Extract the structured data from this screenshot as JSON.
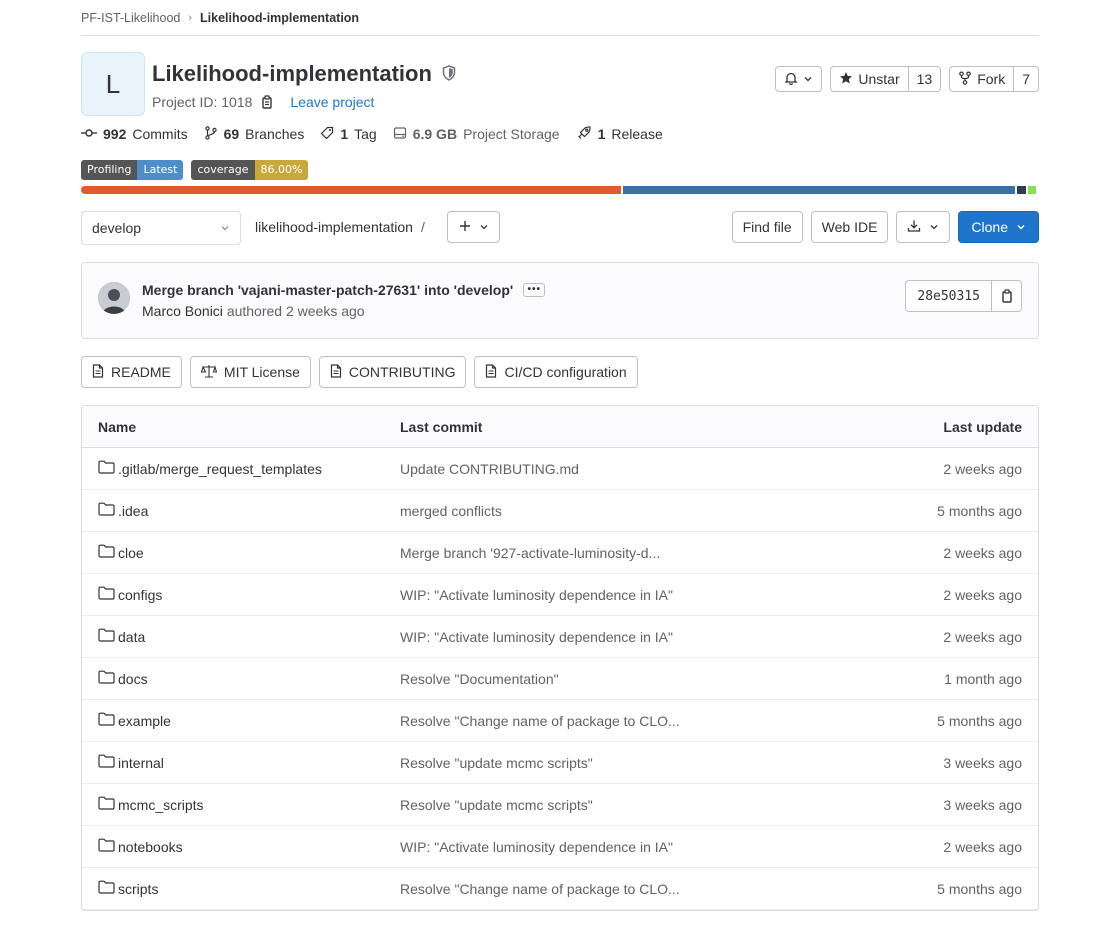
{
  "breadcrumb": {
    "group": "PF-IST-Likelihood",
    "project": "Likelihood-implementation"
  },
  "project": {
    "avatar_letter": "L",
    "name": "Likelihood-implementation",
    "id_text": "Project ID: 1018",
    "leave_label": "Leave project"
  },
  "actions": {
    "star_label": "Unstar",
    "star_count": "13",
    "fork_label": "Fork",
    "fork_count": "7"
  },
  "stats": {
    "commits_num": "992",
    "commits_label": "Commits",
    "branches_num": "69",
    "branches_label": "Branches",
    "tags_num": "1",
    "tags_label": "Tag",
    "storage_num": "6.9 GB",
    "storage_label": "Project Storage",
    "releases_num": "1",
    "releases_label": "Release"
  },
  "badges": [
    {
      "left": "Profiling",
      "right": "Latest"
    },
    {
      "left": "coverage",
      "right": "86.00%"
    }
  ],
  "language_bar": [
    {
      "share": 0.567,
      "color": "#e05d2a"
    },
    {
      "share": 0.412,
      "color": "#3572a5"
    },
    {
      "share": 0.009,
      "color": "#2e3e4e"
    },
    {
      "share": 0.009,
      "color": "#89e051"
    }
  ],
  "toolbar": {
    "branch": "develop",
    "path": "likelihood-implementation",
    "path_sep": "/",
    "find_file": "Find file",
    "web_ide": "Web IDE",
    "clone": "Clone"
  },
  "last_commit": {
    "message": "Merge branch 'vajani-master-patch-27631' into 'develop'",
    "author": "Marco Bonici",
    "authored": "authored",
    "time": "2 weeks ago",
    "sha": "28e50315"
  },
  "project_buttons": {
    "readme": "README",
    "license": "MIT License",
    "contributing": "CONTRIBUTING",
    "cicd": "CI/CD configuration"
  },
  "table": {
    "headers": {
      "name": "Name",
      "commit": "Last commit",
      "update": "Last update"
    },
    "rows": [
      {
        "name": ".gitlab/merge_request_templates",
        "commit": "Update CONTRIBUTING.md",
        "update": "2 weeks ago"
      },
      {
        "name": ".idea",
        "commit": "merged conflicts",
        "update": "5 months ago"
      },
      {
        "name": "cloe",
        "commit": "Merge branch '927-activate-luminosity-d...",
        "update": "2 weeks ago"
      },
      {
        "name": "configs",
        "commit": "WIP: \"Activate luminosity dependence in IA\"",
        "update": "2 weeks ago"
      },
      {
        "name": "data",
        "commit": "WIP: \"Activate luminosity dependence in IA\"",
        "update": "2 weeks ago"
      },
      {
        "name": "docs",
        "commit": "Resolve \"Documentation\"",
        "update": "1 month ago"
      },
      {
        "name": "example",
        "commit": "Resolve \"Change name of package to CLO...",
        "update": "5 months ago"
      },
      {
        "name": "internal",
        "commit": "Resolve \"update mcmc scripts\"",
        "update": "3 weeks ago"
      },
      {
        "name": "mcmc_scripts",
        "commit": "Resolve \"update mcmc scripts\"",
        "update": "3 weeks ago"
      },
      {
        "name": "notebooks",
        "commit": "WIP: \"Activate luminosity dependence in IA\"",
        "update": "2 weeks ago"
      },
      {
        "name": "scripts",
        "commit": "Resolve \"Change name of package to CLO...",
        "update": "5 months ago"
      }
    ]
  }
}
